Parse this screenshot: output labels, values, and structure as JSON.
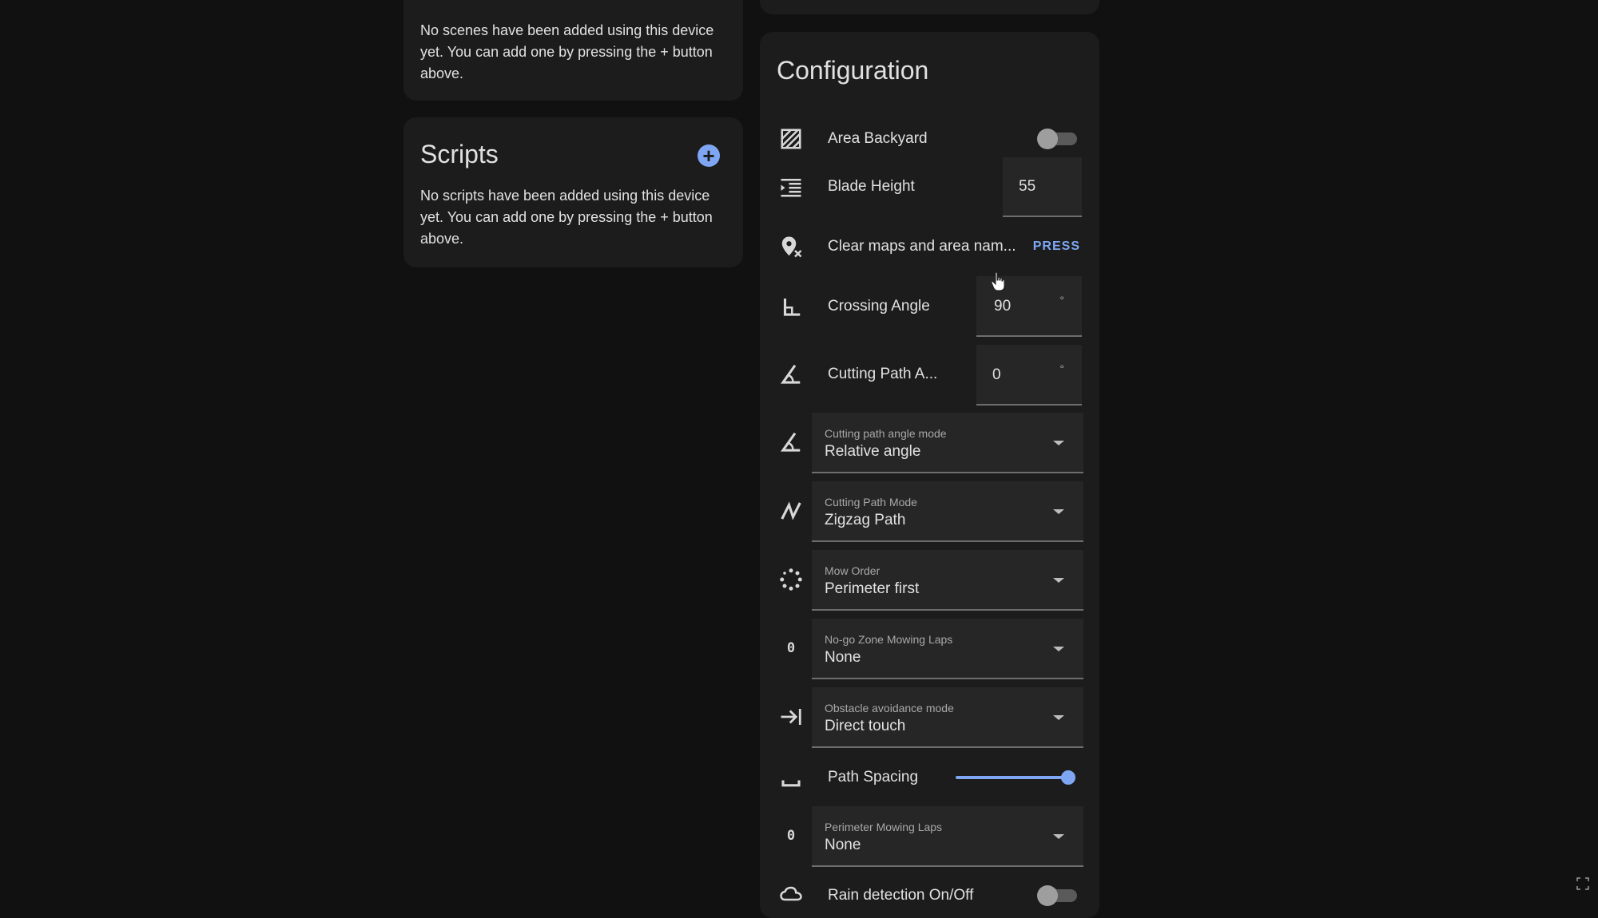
{
  "scenes": {
    "empty_text": "No scenes have been added using this device yet. You can add one by pressing the + button above."
  },
  "scripts": {
    "title": "Scripts",
    "add_symbol": "+",
    "empty_text": "No scripts have been added using this device yet. You can add one by pressing the + button above."
  },
  "configuration": {
    "title": "Configuration",
    "area_backyard": {
      "label": "Area Backyard",
      "icon": "texture-box-icon",
      "on": false
    },
    "blade_height": {
      "label": "Blade Height",
      "icon": "blade-height-icon",
      "value": "55"
    },
    "clear_maps": {
      "label": "Clear maps and area nam...",
      "icon": "map-marker-remove-icon",
      "button": "PRESS"
    },
    "crossing_angle": {
      "label": "Crossing Angle",
      "icon": "angle-right-icon",
      "value": "90",
      "unit": "°"
    },
    "cutting_path_angle": {
      "label": "Cutting Path A...",
      "icon": "angle-acute-icon",
      "value": "0",
      "unit": "°"
    },
    "cutting_path_angle_mode": {
      "label": "Cutting path angle mode",
      "value": "Relative angle",
      "icon": "angle-acute-icon"
    },
    "cutting_path_mode": {
      "label": "Cutting Path Mode",
      "value": "Zigzag Path",
      "icon": "zigzag-icon"
    },
    "mow_order": {
      "label": "Mow Order",
      "value": "Perimeter first",
      "icon": "dots-circle-icon"
    },
    "no_go_zone_laps": {
      "label": "No-go Zone Mowing Laps",
      "value": "None",
      "icon": "numeric-zero-icon",
      "icon_text": "0"
    },
    "obstacle_avoidance_mode": {
      "label": "Obstacle avoidance mode",
      "value": "Direct touch",
      "icon": "arrow-collapse-right-icon"
    },
    "path_spacing": {
      "label": "Path Spacing",
      "icon": "space-bar-icon",
      "level": 1.0
    },
    "perimeter_laps": {
      "label": "Perimeter Mowing Laps",
      "value": "None",
      "icon": "numeric-zero-icon",
      "icon_text": "0"
    },
    "rain_detection": {
      "label": "Rain detection On/Off",
      "icon": "weather-rain-icon",
      "on": false
    }
  },
  "colors": {
    "background": "#111111",
    "card": "#1c1c1c",
    "accent": "#7ea6f2",
    "field": "#262626"
  }
}
